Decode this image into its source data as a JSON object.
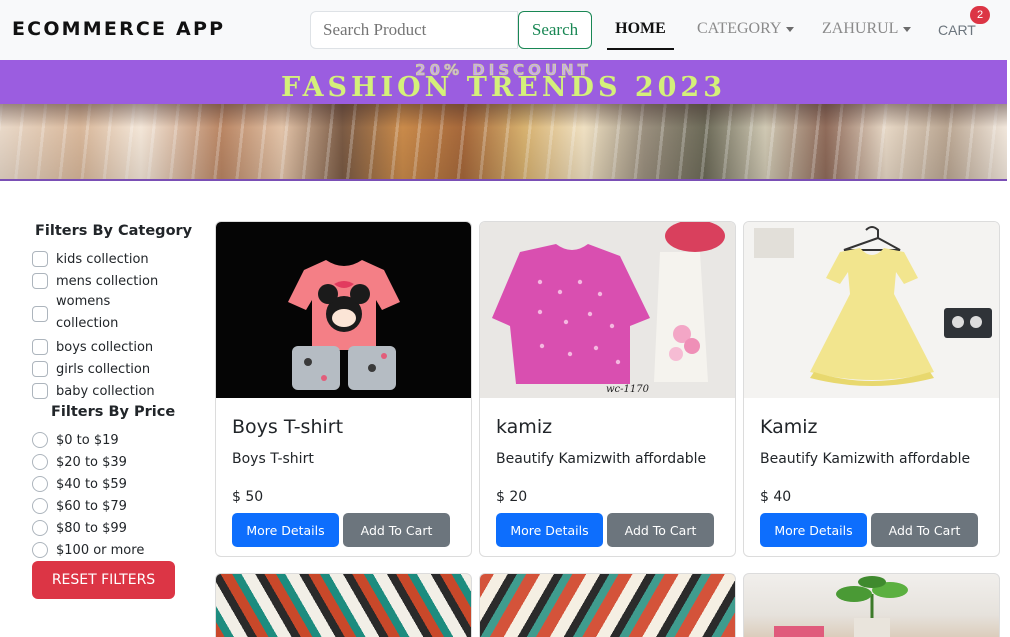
{
  "header": {
    "brand": "ECOMMERCE APP",
    "search": {
      "placeholder": "Search Product",
      "button_label": "Search"
    },
    "nav": {
      "home": "HOME",
      "category": "CATEGORY",
      "user": "ZAHURUL",
      "cart": "CART",
      "cart_count": "2"
    }
  },
  "banner": {
    "discount": "20% DISCOUNT",
    "title": "FASHION TRENDS 2023"
  },
  "filters": {
    "category_title": "Filters By Category",
    "categories": [
      "kids collection",
      "mens collection",
      "womens",
      "collection",
      "boys collection",
      "girls collection",
      "baby collection"
    ],
    "price_title": "Filters By Price",
    "prices": [
      "$0 to $19",
      "$20 to $39",
      "$40 to $59",
      "$60 to $79",
      "$80 to $99",
      "$100 or more"
    ],
    "reset_label": "RESET FILTERS"
  },
  "products": [
    {
      "name": "Boys T-shirt",
      "description": "Boys T-shirt",
      "price": "$ 50",
      "details_label": "More Details",
      "cart_label": "Add To Cart"
    },
    {
      "name": "kamiz",
      "description": "Beautify Kamizwith affordable",
      "price": "$ 20",
      "details_label": "More Details",
      "cart_label": "Add To Cart",
      "image_caption": "wc-1170"
    },
    {
      "name": "Kamiz",
      "description": "Beautify Kamizwith affordable",
      "price": "$ 40",
      "details_label": "More Details",
      "cart_label": "Add To Cart"
    }
  ],
  "colors": {
    "primary": "#0d6efd",
    "secondary": "#6c757d",
    "danger": "#dc3545",
    "success": "#198754",
    "banner_purple": "#9b5de0"
  }
}
